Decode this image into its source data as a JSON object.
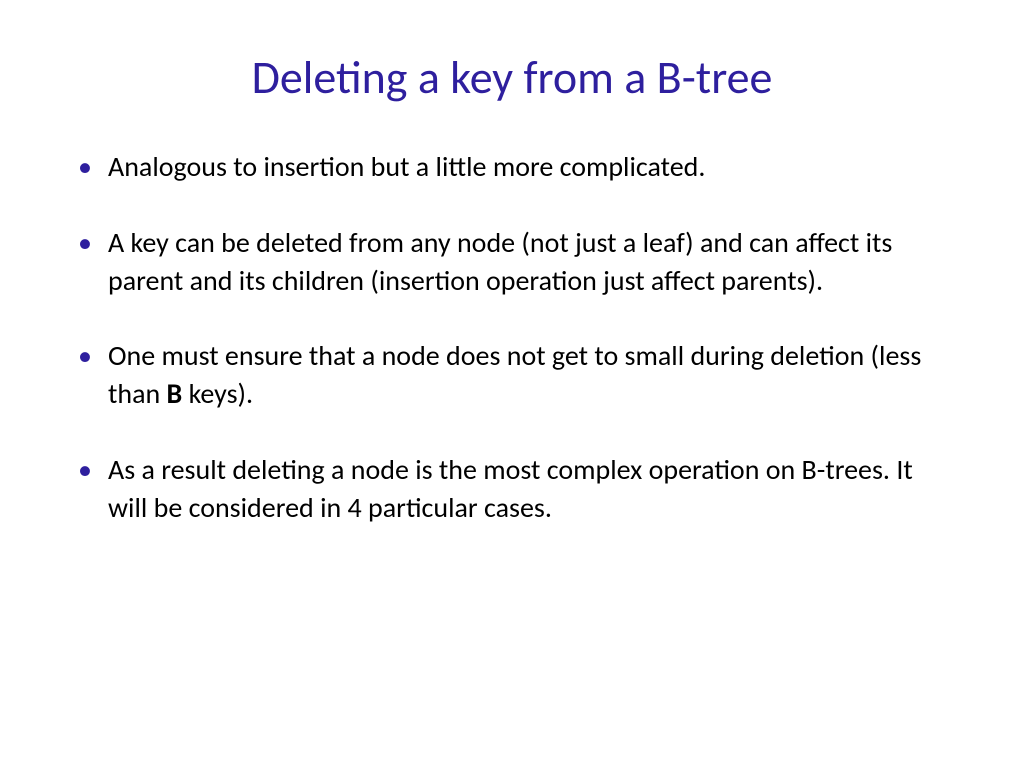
{
  "slide": {
    "title": "Deleting a key from a B-tree",
    "bullets": [
      {
        "pre": "Analogous to insertion but a little more complicated.",
        "bold": "",
        "post": ""
      },
      {
        "pre": "A key can be deleted from any node (not just a leaf) and can affect  its parent and its children (insertion operation just affect parents).",
        "bold": "",
        "post": ""
      },
      {
        "pre": "One must ensure that a node does not get to small during deletion (less than ",
        "bold": "B",
        "post": " keys)."
      },
      {
        "pre": "As a result deleting a node is the most complex operation on B-trees. It will be considered  in 4 particular cases.",
        "bold": "",
        "post": ""
      }
    ]
  }
}
